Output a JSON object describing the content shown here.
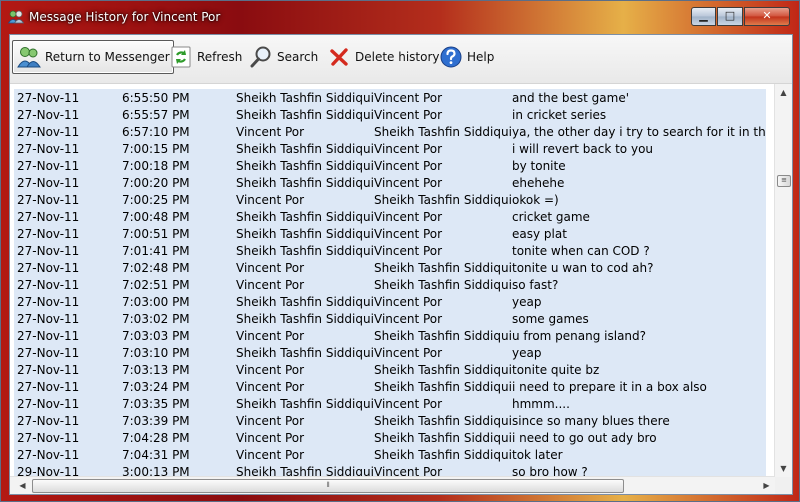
{
  "window": {
    "title": "Message History for Vincent Por",
    "controls": {
      "minimize": "▁",
      "maximize": "□",
      "close": "✕"
    }
  },
  "toolbar": {
    "return_label": "Return to Messenger",
    "refresh_label": "Refresh",
    "search_label": "Search",
    "delete_label": "Delete history",
    "help_label": "Help"
  },
  "messages": [
    {
      "date": "27-Nov-11",
      "time": "6:55:50 PM",
      "from": "Sheikh Tashfin Siddiqui",
      "to": "Vincent Por",
      "text": "and the best game'"
    },
    {
      "date": "27-Nov-11",
      "time": "6:55:57 PM",
      "from": "Sheikh Tashfin Siddiqui",
      "to": "Vincent Por",
      "text": "in cricket series"
    },
    {
      "date": "27-Nov-11",
      "time": "6:57:10 PM",
      "from": "Vincent Por",
      "to": "Sheikh Tashfin Siddiqui",
      "text": "ya, the other day i try to search for it in the intern"
    },
    {
      "date": "27-Nov-11",
      "time": "7:00:15 PM",
      "from": "Sheikh Tashfin Siddiqui",
      "to": "Vincent Por",
      "text": "i will revert back to you"
    },
    {
      "date": "27-Nov-11",
      "time": "7:00:18 PM",
      "from": "Sheikh Tashfin Siddiqui",
      "to": "Vincent Por",
      "text": "by tonite"
    },
    {
      "date": "27-Nov-11",
      "time": "7:00:20 PM",
      "from": "Sheikh Tashfin Siddiqui",
      "to": "Vincent Por",
      "text": "ehehehe"
    },
    {
      "date": "27-Nov-11",
      "time": "7:00:25 PM",
      "from": "Vincent Por",
      "to": "Sheikh Tashfin Siddiqui",
      "text": "okok =)"
    },
    {
      "date": "27-Nov-11",
      "time": "7:00:48 PM",
      "from": "Sheikh Tashfin Siddiqui",
      "to": "Vincent Por",
      "text": "cricket game"
    },
    {
      "date": "27-Nov-11",
      "time": "7:00:51 PM",
      "from": "Sheikh Tashfin Siddiqui",
      "to": "Vincent Por",
      "text": "easy plat"
    },
    {
      "date": "27-Nov-11",
      "time": "7:01:41 PM",
      "from": "Sheikh Tashfin Siddiqui",
      "to": "Vincent Por",
      "text": "tonite when can COD ?"
    },
    {
      "date": "27-Nov-11",
      "time": "7:02:48 PM",
      "from": "Vincent Por",
      "to": "Sheikh Tashfin Siddiqui",
      "text": "tonite u wan to cod ah?"
    },
    {
      "date": "27-Nov-11",
      "time": "7:02:51 PM",
      "from": "Vincent Por",
      "to": "Sheikh Tashfin Siddiqui",
      "text": "so fast?"
    },
    {
      "date": "27-Nov-11",
      "time": "7:03:00 PM",
      "from": "Sheikh Tashfin Siddiqui",
      "to": "Vincent Por",
      "text": "yeap"
    },
    {
      "date": "27-Nov-11",
      "time": "7:03:02 PM",
      "from": "Sheikh Tashfin Siddiqui",
      "to": "Vincent Por",
      "text": "some games"
    },
    {
      "date": "27-Nov-11",
      "time": "7:03:03 PM",
      "from": "Vincent Por",
      "to": "Sheikh Tashfin Siddiqui",
      "text": "u from penang island?"
    },
    {
      "date": "27-Nov-11",
      "time": "7:03:10 PM",
      "from": "Sheikh Tashfin Siddiqui",
      "to": "Vincent Por",
      "text": "yeap"
    },
    {
      "date": "27-Nov-11",
      "time": "7:03:13 PM",
      "from": "Vincent Por",
      "to": "Sheikh Tashfin Siddiqui",
      "text": "tonite quite bz"
    },
    {
      "date": "27-Nov-11",
      "time": "7:03:24 PM",
      "from": "Vincent Por",
      "to": "Sheikh Tashfin Siddiqui",
      "text": "i need to prepare it in a box also"
    },
    {
      "date": "27-Nov-11",
      "time": "7:03:35 PM",
      "from": "Sheikh Tashfin Siddiqui",
      "to": "Vincent Por",
      "text": "hmmm...."
    },
    {
      "date": "27-Nov-11",
      "time": "7:03:39 PM",
      "from": "Vincent Por",
      "to": "Sheikh Tashfin Siddiqui",
      "text": "since so many blues there"
    },
    {
      "date": "27-Nov-11",
      "time": "7:04:28 PM",
      "from": "Vincent Por",
      "to": "Sheikh Tashfin Siddiqui",
      "text": "i need to go out ady bro"
    },
    {
      "date": "27-Nov-11",
      "time": "7:04:31 PM",
      "from": "Vincent Por",
      "to": "Sheikh Tashfin Siddiqui",
      "text": "tok later"
    },
    {
      "date": "29-Nov-11",
      "time": "3:00:13 PM",
      "from": "Sheikh Tashfin Siddiqui",
      "to": "Vincent Por",
      "text": "so bro how ?"
    }
  ],
  "colors": {
    "row_highlight": "#dde8f6",
    "title_text": "#ffffff"
  }
}
